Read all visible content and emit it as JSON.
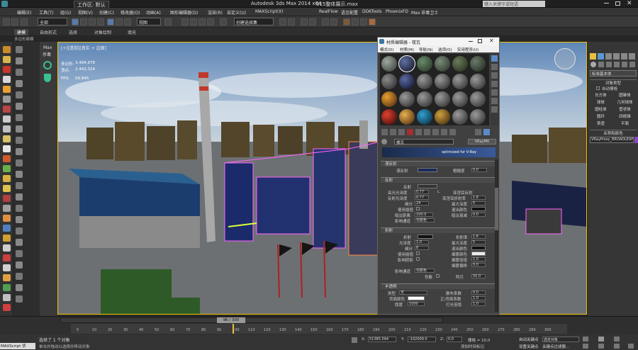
{
  "window": {
    "workspace": "工作区: 默认",
    "title": "Autodesk 3ds Max  2014 x64",
    "file": "015整体展示.max",
    "search_placeholder": "键入关键字或短语"
  },
  "menu": [
    "编辑(E)",
    "工具(T)",
    "组(G)",
    "视图(V)",
    "创建(C)",
    "修改器(O)",
    "动画(A)",
    "图形编辑器(D)",
    "渲染(R)",
    "自定义(U)",
    "MAXScript(X)",
    "RealFlow",
    "语言配置",
    "DDKTools",
    "PhoenixFD",
    "Max 非毒卫士"
  ],
  "toolbar": {
    "filter_select": "全部",
    "view_select": "视图",
    "selection_set": "创建选择集"
  },
  "ribbon": {
    "tabs": [
      "建模",
      "自由形式",
      "选择",
      "对象绘制",
      "填充"
    ],
    "sub": "多边形建模"
  },
  "left_panel": {
    "label": "Max",
    "sub": "杀毒"
  },
  "viewport": {
    "label": "[+][透视][真实 + 边面]",
    "stats": [
      {
        "label": "多边形:",
        "value": "3,484,978"
      },
      {
        "label": "顶点:",
        "value": "2,442,324"
      },
      {
        "label": "FPS:",
        "value": "59.845"
      }
    ]
  },
  "material_editor": {
    "title": "材质编辑器 - 楼瓦",
    "menus": [
      "模式(D)",
      "材质(M)",
      "导航(N)",
      "选项(O)",
      "实用程序(U)"
    ],
    "map_name": "楼瓦",
    "map_type": "VRayMtl",
    "vray_tag": "optimized for V-Ray",
    "sections": {
      "diffuse": "漫反射",
      "reflection": "反射",
      "refraction": "折射",
      "translucency": "半透明"
    },
    "labels": {
      "diffuse": "漫反射",
      "roughness": "粗糙度",
      "reflect": "反射",
      "hilight": "高光光泽度",
      "refl_gloss": "反射光泽度",
      "subdivs": "细分",
      "use_interp": "使用插值",
      "dim_dist": "暗淡距离",
      "dim_falloff": "暗淡衰减",
      "affect_ch": "影响通道",
      "only_color": "仅颜色",
      "fresnel": "菲涅耳反射",
      "fresnel_ior": "菲涅耳折射率",
      "max_depth": "最大深度",
      "exit_color": "退出颜色",
      "refract": "折射",
      "ior": "折射率",
      "gloss": "光泽度",
      "fog_color": "烟雾颜色",
      "fog_mult": "烟雾倍增",
      "fog_bias": "烟雾偏移",
      "affect_shadows": "影响阴影",
      "dispersion": "色散",
      "abbe": "阿贝",
      "trans_type": "类型",
      "trans_none": "无",
      "back_color": "背面颜色",
      "thickness": "厚度",
      "scatter": "散布系数",
      "fwd_back": "正/背面系数",
      "light_mult": "灯光倍增",
      "l_tag": "L"
    },
    "values": {
      "roughness": "0.0",
      "hilight": "0.77",
      "refl_gloss": "0.77",
      "subdivs": "24",
      "dim_dist": "100.0",
      "dim_falloff": "0.0",
      "fresnel_ior": "1.6",
      "max_depth": "5",
      "ior": "1.6",
      "gloss": "1.0",
      "r_subdivs": "8",
      "r_max_depth": "5",
      "fog_mult": "1.0",
      "fog_bias": "0.0",
      "abbe": "50.0",
      "thickness": "1000",
      "scatter": "0.0",
      "fwd_back": "1.0",
      "light_mult": "1.0"
    }
  },
  "command_panel": {
    "selector": "标准基本体",
    "object_type": "对象类型",
    "auto_grid": "自动栅格",
    "buttons": [
      "长方体",
      "圆锥体",
      "球体",
      "几何球体",
      "圆柱体",
      "管状体",
      "圆环",
      "四棱锥",
      "茶壶",
      "平面"
    ],
    "name_color": "名称和颜色",
    "name_value": "VRayProxy_BROADLEAF-"
  },
  "timeline": {
    "frame": "96 / 300",
    "ticks": [
      "0",
      "10",
      "20",
      "30",
      "40",
      "50",
      "60",
      "70",
      "80",
      "90",
      "100",
      "110",
      "120",
      "130",
      "140",
      "150",
      "160",
      "170",
      "180",
      "190",
      "200",
      "210",
      "220",
      "230",
      "240",
      "250",
      "260",
      "270",
      "280",
      "290",
      "300"
    ]
  },
  "status": {
    "selected": "选择了 1 个对象",
    "prompt": "单击并拖动以选择并移动对象",
    "maxscript": "MAXScript 侦",
    "x_label": "X:",
    "x": "51385.594",
    "y_label": "Y:",
    "y": "-102009.0",
    "z_label": "Z:",
    "z": "0.0",
    "grid": "栅格 = 10.0",
    "add_time": "添加时间标记",
    "auto_key": "自动关键点",
    "set_key": "设置关键点",
    "sel_obj": "选定对象",
    "key_filter": "关键点过滤器..."
  }
}
